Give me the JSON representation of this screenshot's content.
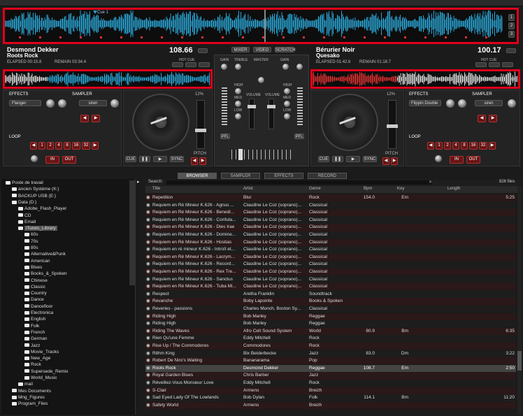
{
  "overview": {
    "cue_label": "Cue 1",
    "side_nums": [
      "1",
      "2",
      "3"
    ]
  },
  "deck_left": {
    "artist": "Desmond Dekker",
    "title": "Roots Rock",
    "bpm": "108.66",
    "elapsed": "ELAPSED 00:15.8",
    "remain": "REMAIN 03:34.4",
    "effects_label": "EFFECTS",
    "effect": "Flanger",
    "sampler_label": "SAMPLER",
    "sampler": "siren",
    "loop_label": "LOOP",
    "loop_nums": [
      "1",
      "2",
      "4",
      "8",
      "16",
      "32"
    ],
    "in": "IN",
    "out": "OUT",
    "cue": "CUE",
    "sync": "SYNC",
    "hot_cue": "HOT CUE",
    "pitch": "PITCH",
    "pct": "12%"
  },
  "deck_right": {
    "artist": "Bérurier Noir",
    "title": "Quesako",
    "bpm": "100.17",
    "elapsed": "ELAPSED 01:42.6",
    "remain": "REMAIN 01:18.7",
    "effects_label": "EFFECTS",
    "effect": "Flippin Double",
    "sampler_label": "SAMPLER",
    "sampler": "siren",
    "loop_label": "LOOP",
    "loop_nums": [
      "1",
      "2",
      "4",
      "8",
      "16",
      "32"
    ],
    "in": "IN",
    "out": "OUT",
    "cue": "CUE",
    "sync": "SYNC",
    "hot_cue": "HOT CUE",
    "pitch": "PITCH",
    "pct": "12%"
  },
  "mixer": {
    "buttons": [
      "MIXER",
      "VIDEO",
      "SCRATCH"
    ],
    "labels": [
      "GAIN",
      "TREBLE",
      "MASTER",
      "GAIN",
      "HIGH",
      "MED",
      "LOW",
      "VOLUME",
      "VOLUME",
      "HIGH",
      "MED",
      "LOW"
    ],
    "pfl": "PFL"
  },
  "tabs": [
    "BROWSER",
    "SAMPLER",
    "EFFECTS",
    "RECORD"
  ],
  "search": {
    "label": "Search:",
    "count": "826 files"
  },
  "tree": [
    {
      "t": "Poste de travail",
      "d": 0
    },
    {
      "t": "ancien Système (K:)",
      "d": 1
    },
    {
      "t": "BACKUP USB (E:)",
      "d": 1
    },
    {
      "t": "Data (D:)",
      "d": 1
    },
    {
      "t": "Adobe_Flash_Player",
      "d": 2
    },
    {
      "t": "CD",
      "d": 2
    },
    {
      "t": "Email",
      "d": 2
    },
    {
      "t": "iTunes_Library",
      "d": 2
    },
    {
      "t": "60s",
      "d": 3
    },
    {
      "t": "70s",
      "d": 3
    },
    {
      "t": "80s",
      "d": 3
    },
    {
      "t": "Alternative&Punk",
      "d": 3
    },
    {
      "t": "American",
      "d": 3
    },
    {
      "t": "Blues",
      "d": 3
    },
    {
      "t": "Books_&_Spoken",
      "d": 3
    },
    {
      "t": "Chinese",
      "d": 3
    },
    {
      "t": "Classic",
      "d": 3
    },
    {
      "t": "Country",
      "d": 3
    },
    {
      "t": "Dance",
      "d": 3
    },
    {
      "t": "Dancefloor",
      "d": 3
    },
    {
      "t": "Electronica",
      "d": 3
    },
    {
      "t": "English",
      "d": 3
    },
    {
      "t": "Folk",
      "d": 3
    },
    {
      "t": "French",
      "d": 3
    },
    {
      "t": "German",
      "d": 3
    },
    {
      "t": "Jazz",
      "d": 3
    },
    {
      "t": "Movie_Tracks",
      "d": 3
    },
    {
      "t": "New_Age",
      "d": 3
    },
    {
      "t": "Rock",
      "d": 3
    },
    {
      "t": "Supersede_Remix",
      "d": 3
    },
    {
      "t": "World_Music",
      "d": 3
    },
    {
      "t": "mail",
      "d": 2
    },
    {
      "t": "Mes Documents",
      "d": 1
    },
    {
      "t": "Mng_Figures",
      "d": 1
    },
    {
      "t": "Program_Files",
      "d": 1
    }
  ],
  "columns": [
    "Title",
    "Artist",
    "Genre",
    "Bpm",
    "Key",
    "Length"
  ],
  "rows": [
    [
      "Repetition",
      "Blur",
      "Rock",
      "154.0",
      "Em",
      "5:25"
    ],
    [
      "Requiem en Ré Mineur K.626 - Agnus ...",
      "Claudine Le Coz (soprano)...",
      "Classical",
      "",
      "",
      ""
    ],
    [
      "Requiem en Ré Mineur K.626 - Benedi...",
      "Claudine Le Coz (soprano)...",
      "Classical",
      "",
      "",
      ""
    ],
    [
      "Requiem en Ré Mineur K.626 - Confuta...",
      "Claudine Le Coz (soprano)...",
      "Classical",
      "",
      "",
      ""
    ],
    [
      "Requiem en Ré Mineur K.626 - Dies Irae",
      "Claudine Le Coz (soprano)...",
      "Classical",
      "",
      "",
      ""
    ],
    [
      "Requiem en Ré Mineur K.626 - Domine...",
      "Claudine Le Coz (soprano)...",
      "Classical",
      "",
      "",
      ""
    ],
    [
      "Requiem en Ré Mineur K.626 - Hostias",
      "Claudine Le Coz (soprano)...",
      "Classical",
      "",
      "",
      ""
    ],
    [
      "Requiem en ré mineur K.626 - Introït et...",
      "Claudine Le Coz (soprano)...",
      "Classical",
      "",
      "",
      ""
    ],
    [
      "Requiem en Ré Mineur K.626 - Lacrym...",
      "Claudine Le Coz (soprano)...",
      "Classical",
      "",
      "",
      ""
    ],
    [
      "Requiem en Ré Mineur K.626 - Record...",
      "Claudine Le Coz (soprano)...",
      "Classical",
      "",
      "",
      ""
    ],
    [
      "Requiem en Ré Mineur K.626 - Rex Tre...",
      "Claudine Le Coz (soprano)...",
      "Classical",
      "",
      "",
      ""
    ],
    [
      "Requiem en Ré Mineur K.626 - Sanctus",
      "Claudine Le Coz (soprano)...",
      "Classical",
      "",
      "",
      ""
    ],
    [
      "Requiem en Ré Mineur K.626 - Tuba Mi...",
      "Claudine Le Coz (soprano)...",
      "Classical",
      "",
      "",
      ""
    ],
    [
      "Respect",
      "Aretha Franklin",
      "Soundtrack",
      "",
      "",
      ""
    ],
    [
      "Revanche",
      "Boby Lapointe",
      "Books & Spoken",
      "",
      "",
      ""
    ],
    [
      "Reveries - passions",
      "Charles Munch, Boston Sy...",
      "Classical",
      "",
      "",
      ""
    ],
    [
      "Riding High",
      "Bob Marley",
      "Reggae",
      "",
      "",
      ""
    ],
    [
      "Riding High",
      "Bob Marley",
      "Reggae",
      "",
      "",
      ""
    ],
    [
      "Riding The Waves",
      "Afro Celt Sound System",
      "World",
      "80.9",
      "Bm",
      "6:35"
    ],
    [
      "Rien Qu'une Femme",
      "Eddy Mitchell",
      "Rock",
      "",
      "",
      ""
    ],
    [
      "Rise Up / The Commodores",
      "Commodores",
      "Rock",
      "",
      "",
      ""
    ],
    [
      "Rithm King",
      "Bix Beiderbecke",
      "Jazz",
      "83.0",
      "Dm",
      "3:22"
    ],
    [
      "Robert De Niro's Waiting",
      "Bananarama",
      "Pop",
      "",
      "",
      ""
    ],
    [
      "Roots Rock",
      "Desmond Dekker",
      "Reggae",
      "108.7",
      "Em",
      "2:50"
    ],
    [
      "Royal Garden Blues",
      "Chris Barber",
      "Jazz",
      "",
      "",
      ""
    ],
    [
      "Réveillez-Vous Monsieur Love",
      "Eddy Mitchell",
      "Rock",
      "",
      "",
      ""
    ],
    [
      "S-Clair",
      "Armens",
      "Breizh",
      "",
      "",
      ""
    ],
    [
      "Sad Eyed Lady Of The Lowlands",
      "Bob Dylan",
      "Folk",
      "114.1",
      "Bm",
      "11:20"
    ],
    [
      "Safety World",
      "Armens",
      "Breizh",
      "",
      "",
      ""
    ]
  ],
  "colors": {
    "accent": "#e0001a",
    "wave_blue": "#2aa8d8",
    "wave_red": "#e03030"
  }
}
